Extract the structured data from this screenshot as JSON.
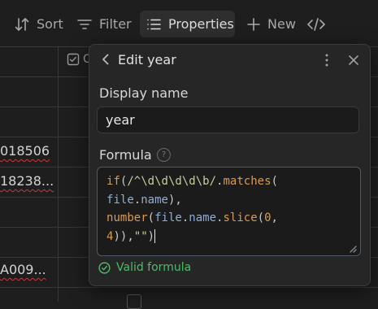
{
  "toolbar": {
    "sort_label": "Sort",
    "filter_label": "Filter",
    "properties_label": "Properties",
    "new_label": "New"
  },
  "table": {
    "column_header_partial": "C",
    "cells": [
      "018506",
      "18238...",
      "A009..."
    ]
  },
  "popover": {
    "title": "Edit year",
    "display_name_label": "Display name",
    "display_name_value": "year",
    "formula_label": "Formula",
    "help_glyph": "?",
    "formula_code": "if(/^\\d\\d\\d\\d\\b/.matches(file.name),\nnumber(file.name.slice(0,4)),\"\")",
    "validation": "Valid formula"
  },
  "colors": {
    "accent_valid": "#51b96a",
    "function": "#d99a52",
    "string": "#c8cd9c",
    "identifier": "#8faed6",
    "error_underline": "#c83a3a"
  }
}
